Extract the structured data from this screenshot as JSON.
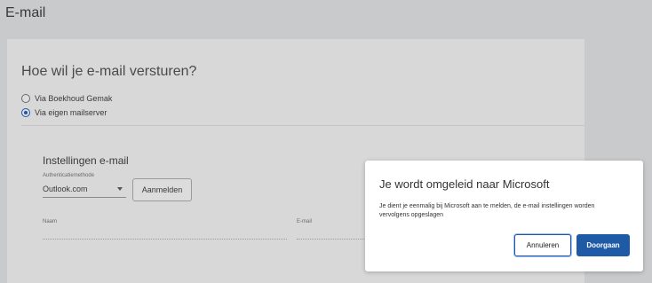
{
  "header": {
    "title": "E-mail"
  },
  "send_method": {
    "question": "Hoe wil je e-mail versturen?",
    "options": [
      {
        "label": "Via Boekhoud Gemak",
        "selected": false
      },
      {
        "label": "Via eigen mailserver",
        "selected": true
      }
    ]
  },
  "settings": {
    "title": "Instellingen e-mail",
    "auth_label": "Authenticatiemethode",
    "auth_value": "Outlook.com",
    "login_button": "Aanmelden",
    "name_label": "Naam",
    "email_label": "E-mail"
  },
  "dialog": {
    "title": "Je wordt omgeleid naar Microsoft",
    "message": "Je dient je eenmalig bij Microsoft aan te melden, de e-mail instellingen worden vervolgens opgeslagen",
    "cancel_label": "Annuleren",
    "continue_label": "Doorgaan"
  },
  "colors": {
    "primary": "#1f5aa6",
    "overlay": "#c9cacb",
    "card": "#d8d8d8"
  }
}
